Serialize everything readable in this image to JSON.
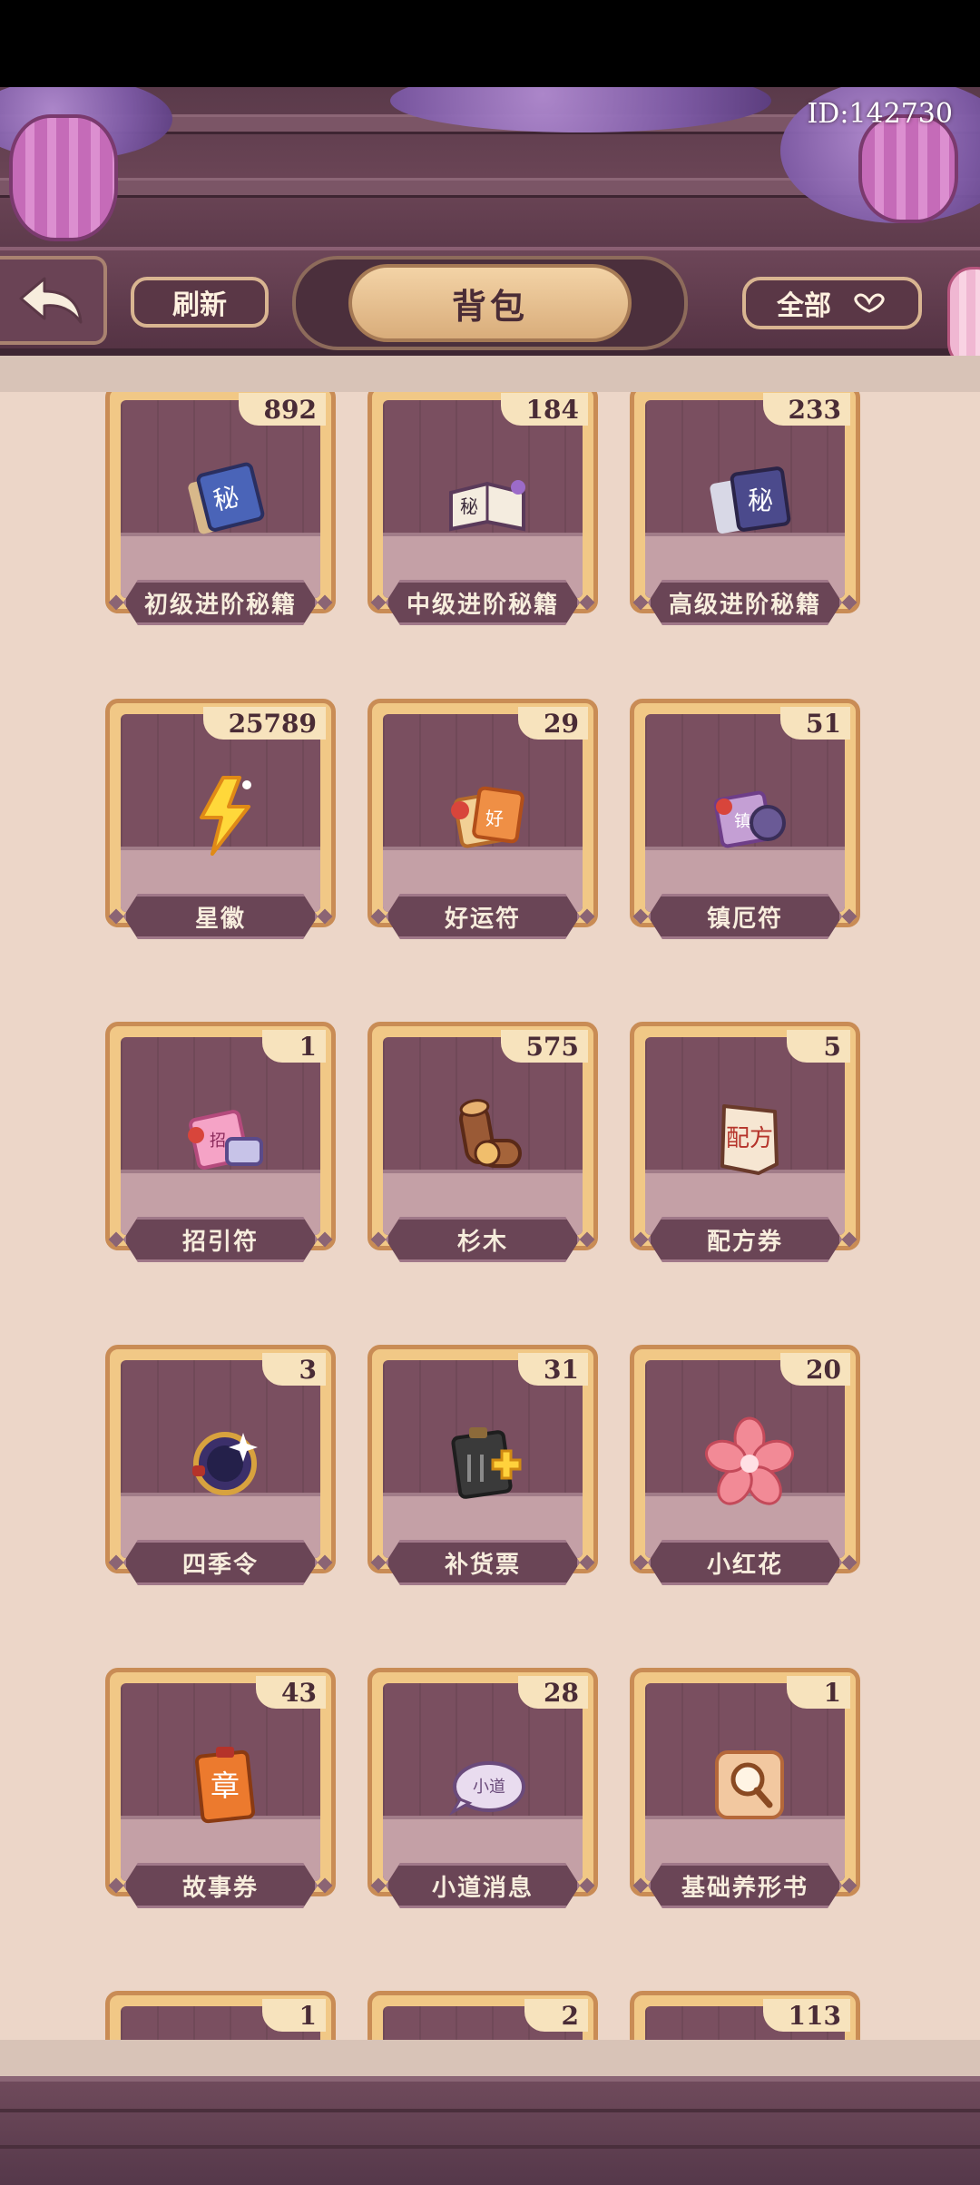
{
  "status_bar": {},
  "header": {
    "user_id": "ID:142730"
  },
  "toolbar": {
    "back_icon": "back-arrow-icon",
    "refresh_label": "刷新",
    "title": "背包",
    "filter_label": "全部",
    "filter_icon": "chevron-down-icon"
  },
  "items": [
    {
      "name": "初级进阶秘籍",
      "qty": "892",
      "icon": "scroll-book-blue-icon"
    },
    {
      "name": "中级进阶秘籍",
      "qty": "184",
      "icon": "scroll-book-white-icon"
    },
    {
      "name": "高级进阶秘籍",
      "qty": "233",
      "icon": "scroll-book-purple-icon"
    },
    {
      "name": "星徽",
      "qty": "25789",
      "icon": "lightning-badge-icon"
    },
    {
      "name": "好运符",
      "qty": "29",
      "icon": "lucky-charm-icon"
    },
    {
      "name": "镇厄符",
      "qty": "51",
      "icon": "ward-charm-icon"
    },
    {
      "name": "招引符",
      "qty": "1",
      "icon": "summon-charm-icon"
    },
    {
      "name": "杉木",
      "qty": "575",
      "icon": "wood-log-icon"
    },
    {
      "name": "配方券",
      "qty": "5",
      "icon": "recipe-coupon-icon"
    },
    {
      "name": "四季令",
      "qty": "3",
      "icon": "season-token-icon"
    },
    {
      "name": "补货票",
      "qty": "31",
      "icon": "restock-ticket-icon"
    },
    {
      "name": "小红花",
      "qty": "20",
      "icon": "red-flower-icon"
    },
    {
      "name": "故事券",
      "qty": "43",
      "icon": "story-ticket-icon"
    },
    {
      "name": "小道消息",
      "qty": "28",
      "icon": "gossip-note-icon"
    },
    {
      "name": "基础养形书",
      "qty": "1",
      "icon": "magnifier-book-icon"
    },
    {
      "name": "",
      "qty": "1",
      "icon": "item-icon"
    },
    {
      "name": "",
      "qty": "2",
      "icon": "item-icon"
    },
    {
      "name": "",
      "qty": "113",
      "icon": "item-icon"
    }
  ]
}
